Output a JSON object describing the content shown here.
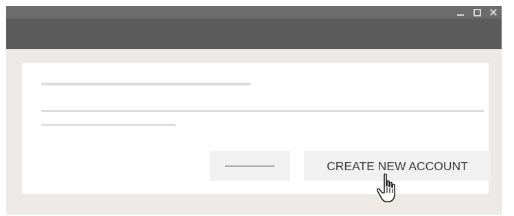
{
  "window": {
    "controls": [
      "minimize-icon",
      "maximize-icon",
      "close-icon"
    ]
  },
  "dialog": {
    "primary_button_label": "CREATE NEW ACCOUNT",
    "secondary_button_label": ""
  },
  "cursor": "pointing-hand-cursor-icon",
  "colors": {
    "titlebar": "#6c6c6c",
    "toolbar": "#5c5c5c",
    "background": "#ece9e6",
    "card": "#ffffff",
    "button": "#f1f1f1"
  }
}
